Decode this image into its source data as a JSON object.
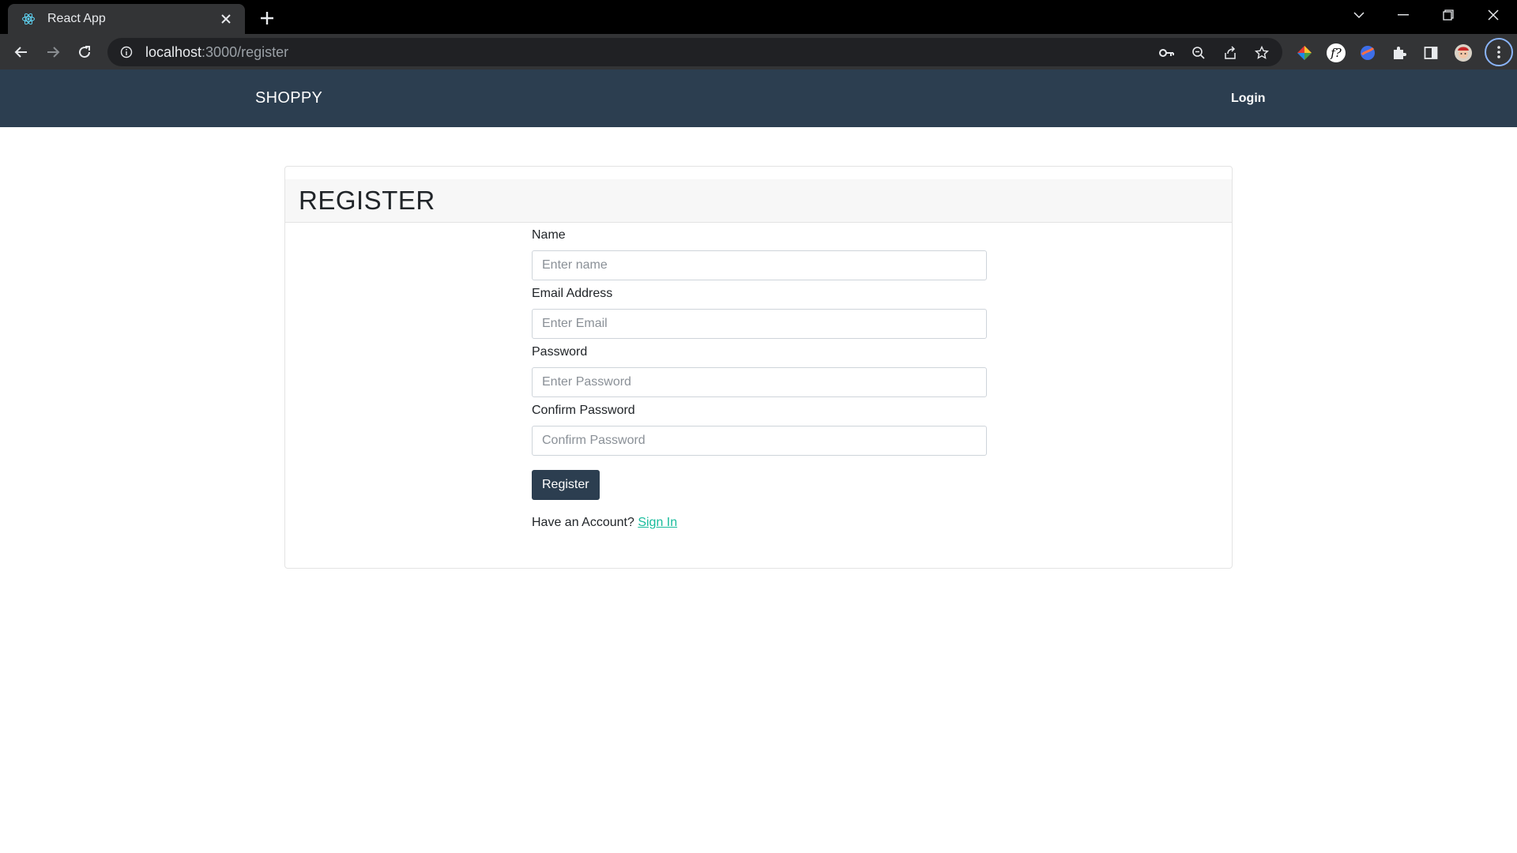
{
  "browser": {
    "tab_title": "React App",
    "url_host": "localhost",
    "url_path": ":3000/register"
  },
  "navbar": {
    "brand": "SHOPPY",
    "login": "Login"
  },
  "register": {
    "title": "REGISTER",
    "fields": [
      {
        "label": "Name",
        "placeholder": "Enter name"
      },
      {
        "label": "Email Address",
        "placeholder": "Enter Email"
      },
      {
        "label": "Password",
        "placeholder": "Enter Password"
      },
      {
        "label": "Confirm Password",
        "placeholder": "Confirm Password"
      }
    ],
    "submit_label": "Register",
    "have_account_text": "Have an Account?",
    "sign_in_link": "Sign In"
  },
  "colors": {
    "navbar_bg": "#2c3e50",
    "button_bg": "#2c3e50",
    "link": "#18bc9c"
  }
}
